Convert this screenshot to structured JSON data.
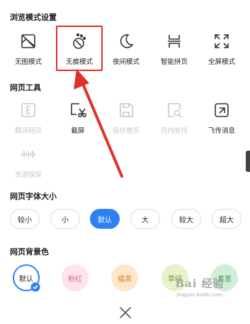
{
  "browse_mode": {
    "title": "浏览模式设置",
    "items": [
      {
        "label": "无图模式",
        "icon": "no-image-icon"
      },
      {
        "label": "无痕模式",
        "icon": "incognito-icon"
      },
      {
        "label": "夜间模式",
        "icon": "moon-icon"
      },
      {
        "label": "智能拼页",
        "icon": "page-join-icon"
      },
      {
        "label": "全屏模式",
        "icon": "fullscreen-icon"
      }
    ]
  },
  "web_tools": {
    "title": "网页工具",
    "items": [
      {
        "label": "翻译网页",
        "icon": "translate-icon",
        "enabled": false
      },
      {
        "label": "截屏",
        "icon": "screenshot-icon",
        "enabled": true
      },
      {
        "label": "保存整页",
        "icon": "save-page-icon",
        "enabled": false
      },
      {
        "label": "页内查找",
        "icon": "find-in-page-icon",
        "enabled": false
      },
      {
        "label": "飞传消息",
        "icon": "send-message-icon",
        "enabled": true
      },
      {
        "label": "资源嗅探",
        "icon": "resource-sniff-icon",
        "enabled": false
      }
    ]
  },
  "font_size": {
    "title": "网页字体大小",
    "options": [
      "较小",
      "小",
      "默认",
      "大",
      "较大",
      "超大"
    ],
    "selected": "默认"
  },
  "background": {
    "title": "网页背景色",
    "options": [
      {
        "label": "默认",
        "color": "#ffffff",
        "selected": true
      },
      {
        "label": "粉红",
        "color": "#fde3ec"
      },
      {
        "label": "橘黄",
        "color": "#fde6cc"
      },
      {
        "label": "草绿",
        "color": "#e8f2c8"
      },
      {
        "label": "青葱",
        "color": "#cfeed7"
      }
    ]
  },
  "accent_color": "#2f80f5",
  "annotation_color": "#e0302a",
  "watermark": {
    "line1": "Bai 经验",
    "line2": "jingyan.baidu.com"
  }
}
